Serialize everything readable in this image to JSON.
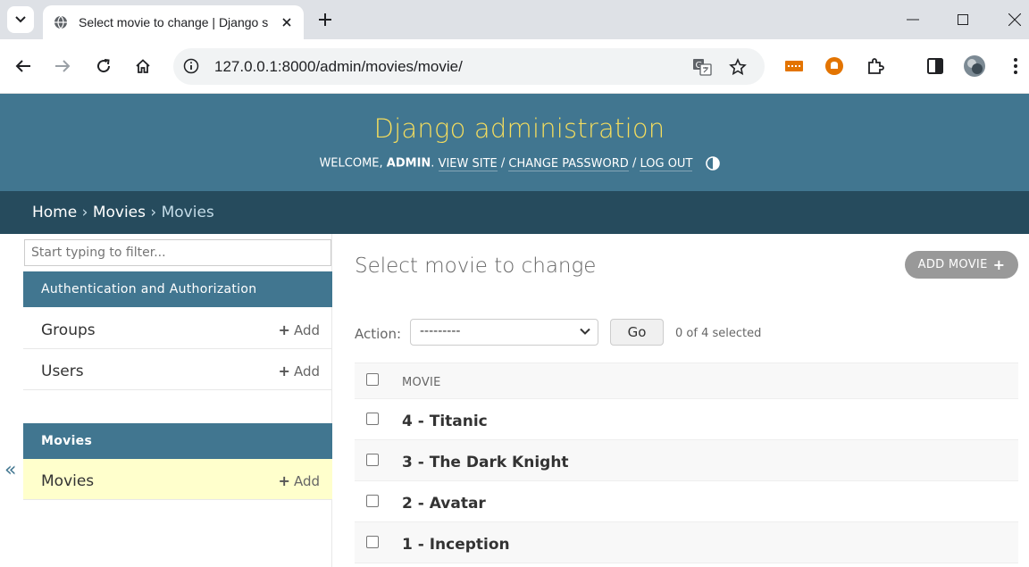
{
  "browser": {
    "tab_title": "Select movie to change | Django site admin",
    "url": "127.0.0.1:8000/admin/movies/movie/"
  },
  "header": {
    "site_title": "Django administration",
    "welcome": "Welcome,",
    "username": "admin",
    "view_site": "View site",
    "change_password": "Change password",
    "log_out": "Log out"
  },
  "breadcrumbs": {
    "home": "Home",
    "app": "Movies",
    "current": "Movies"
  },
  "sidebar": {
    "filter_placeholder": "Start typing to filter...",
    "collapse_glyph": "«",
    "apps": [
      {
        "caption": "Authentication and Authorization",
        "models": [
          {
            "name": "Groups",
            "add": "Add"
          },
          {
            "name": "Users",
            "add": "Add"
          }
        ]
      },
      {
        "caption": "Movies",
        "models": [
          {
            "name": "Movies",
            "add": "Add"
          }
        ]
      }
    ]
  },
  "content": {
    "title": "Select movie to change",
    "add_button": "Add movie",
    "action_label": "Action:",
    "action_selected": "---------",
    "go_button": "Go",
    "counter": "0 of 4 selected",
    "column_header": "Movie",
    "rows": [
      "4 - Titanic",
      "3 - The Dark Knight",
      "2 - Avatar",
      "1 - Inception"
    ]
  },
  "colors": {
    "header_bg": "#417690",
    "title_yellow": "#f5dd5d",
    "breadcrumb_bg": "#264b5d",
    "current_model_bg": "#ffffcc"
  }
}
